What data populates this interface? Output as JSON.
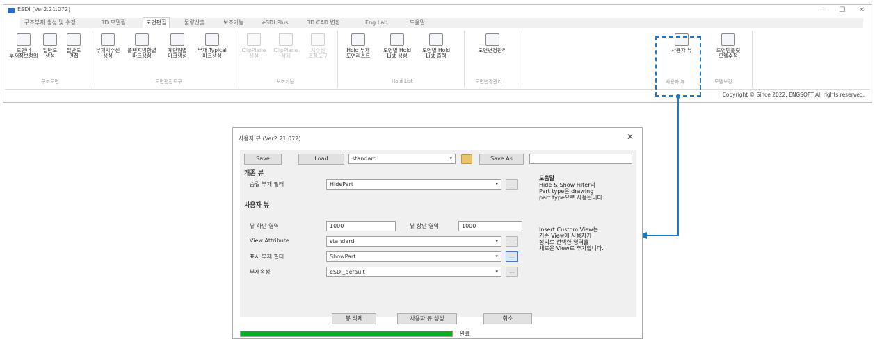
{
  "app": {
    "title": "ESDI (Ver2.21.072)",
    "controls": {
      "minimize": "—",
      "maximize": "☐",
      "close": "✕"
    }
  },
  "tabs": [
    {
      "label": "구조부재 생성 및 수정"
    },
    {
      "label": "3D 모델링"
    },
    {
      "label": "도면편집",
      "active": true
    },
    {
      "label": "물량산출"
    },
    {
      "label": "보조기능"
    },
    {
      "label": "eSDI Plus"
    },
    {
      "label": "3D CAD 변환"
    },
    {
      "label": "Eng Lab"
    },
    {
      "label": "도움말"
    }
  ],
  "ribbon": {
    "buttons": [
      {
        "name": "ribbon-btn-member-info",
        "label": "도면내\n부재정보정의",
        "enabled": true
      },
      {
        "name": "ribbon-btn-general-create",
        "label": "일반도\n생성",
        "enabled": true
      },
      {
        "name": "ribbon-btn-general-edit",
        "label": "일반도\n편집",
        "enabled": true
      },
      {
        "name": "ribbon-btn-member-dim",
        "label": "부재치수선\n생성",
        "enabled": true
      },
      {
        "name": "ribbon-btn-flange-mark",
        "label": "플랜지방향별\n마크생성",
        "enabled": true
      },
      {
        "name": "ribbon-btn-stair-mark",
        "label": "계단형별\n마크생성",
        "enabled": true
      },
      {
        "name": "ribbon-btn-typical-mark",
        "label": "부재 Typical\n마크생성",
        "enabled": true
      },
      {
        "name": "ribbon-btn-clipplane-create",
        "label": "ClipPlane\n생성",
        "enabled": false
      },
      {
        "name": "ribbon-btn-clipplane-delete",
        "label": "ClipPlane\n삭제",
        "enabled": false
      },
      {
        "name": "ribbon-btn-dim-tool",
        "label": "치수선\n조정도구",
        "enabled": false
      },
      {
        "name": "ribbon-btn-hold-list",
        "label": "Hold 부재\n도면리스트",
        "enabled": true
      },
      {
        "name": "ribbon-btn-hold-create",
        "label": "도면별 Hold\nList 생성",
        "enabled": true
      },
      {
        "name": "ribbon-btn-hold-print",
        "label": "도면별 Hold\nList 출력",
        "enabled": true
      },
      {
        "name": "ribbon-btn-drawing-manage",
        "label": "도면변경관리",
        "enabled": true
      },
      {
        "name": "ribbon-btn-user-view",
        "label": "사용자 뷰",
        "enabled": true
      },
      {
        "name": "ribbon-btn-template-edit",
        "label": "도면템플릿\n모델수정",
        "enabled": true
      }
    ],
    "groups": [
      "구조도면",
      "도면편집도구",
      "보조기능",
      "Hold List",
      "도면변경관리",
      "사용자 뷰",
      "모델보강"
    ]
  },
  "status": {
    "copyright": "Copyright © Since 2022. ENGSOFT All rights reserved."
  },
  "dialog": {
    "title": "사용자 뷰 (Ver2.21.072)",
    "close": "✕",
    "save_label": "Save",
    "load_label": "Load",
    "preset_value": "standard",
    "save_as_label": "Save As",
    "save_as_name": "",
    "section_existing": "개존 뷰",
    "hide_filter_label": "숨길 부재 필터",
    "hide_filter_value": "HidePart",
    "section_user": "사용자 뷰",
    "view_bottom_label": "뷰 하단 영역",
    "view_bottom_value": "1000",
    "view_top_label": "뷰 상단 영역",
    "view_top_value": "1000",
    "view_attr_label": "View Attribute",
    "view_attr_value": "standard",
    "show_filter_label": "표시 부재 필터",
    "show_filter_value": "ShowPart",
    "member_attr_label": "부재속성",
    "member_attr_value": "eSDI_default",
    "help_title": "도움말",
    "help_existing": "Hide & Show Filter의\nPart type은 drawing\npart type으로 사용됩니다.",
    "help_user": "Insert Custom View는\n기존 View에 사용자가\n정의로 선택한 영역을\n새로운 View로 추가합니다.",
    "delete_view_label": "뷰 삭제",
    "create_view_label": "사용자 뷰 생성",
    "cancel_label": "취소",
    "progress_percent": 100,
    "progress_label": "완료"
  },
  "colors": {
    "accent": "#1e78c8",
    "progress": "#06b025"
  }
}
